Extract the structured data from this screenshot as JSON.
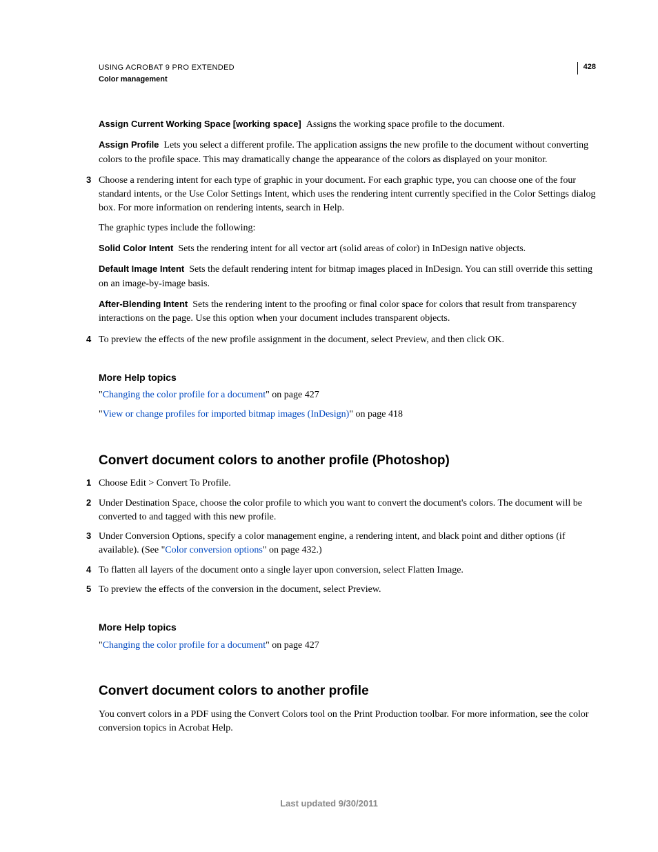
{
  "header": {
    "line1": "USING ACROBAT 9 PRO EXTENDED",
    "line2": "Color management",
    "page_number": "428"
  },
  "defs": [
    {
      "term": "Assign Current Working Space [working space]",
      "text": "Assigns the working space profile to the document."
    },
    {
      "term": "Assign Profile",
      "text": "Lets you select a different profile. The application assigns the new profile to the document without converting colors to the profile space. This may dramatically change the appearance of the colors as displayed on your monitor."
    }
  ],
  "step3": {
    "num": "3",
    "text": "Choose a rendering intent for each type of graphic in your document. For each graphic type, you can choose one of the four standard intents, or the Use Color Settings Intent, which uses the rendering intent currently specified in the Color Settings dialog box. For more information on rendering intents, search in Help."
  },
  "graphic_intro": "The graphic types include the following:",
  "intent_defs": [
    {
      "term": "Solid Color Intent",
      "text": "Sets the rendering intent for all vector art (solid areas of color) in InDesign native objects."
    },
    {
      "term": "Default Image Intent",
      "text": "Sets the default rendering intent for bitmap images placed in InDesign. You can still override this setting on an image-by-image basis."
    },
    {
      "term": "After-Blending Intent",
      "text": "Sets the rendering intent to the proofing or final color space for colors that result from transparency interactions on the page. Use this option when your document includes transparent objects."
    }
  ],
  "step4": {
    "num": "4",
    "text": "To preview the effects of the new profile assignment in the document, select Preview, and then click OK."
  },
  "more_help_1": {
    "title": "More Help topics",
    "links": [
      {
        "text": "Changing the color profile for a document",
        "suffix": "\" on page 427"
      },
      {
        "text": "View or change profiles for imported bitmap images (InDesign)",
        "suffix": "\" on page 418"
      }
    ]
  },
  "section2": {
    "title": "Convert document colors to another profile (Photoshop)",
    "steps": [
      {
        "num": "1",
        "text": "Choose Edit > Convert To Profile."
      },
      {
        "num": "2",
        "text": "Under Destination Space, choose the color profile to which you want to convert the document's colors. The document will be converted to and tagged with this new profile."
      },
      {
        "num": "3",
        "pre": "Under Conversion Options, specify a color management engine, a rendering intent, and black point and dither options (if available). (See \"",
        "link": "Color conversion options",
        "post": "\" on page 432.)"
      },
      {
        "num": "4",
        "text": "To flatten all layers of the document onto a single layer upon conversion, select Flatten Image."
      },
      {
        "num": "5",
        "text": "To preview the effects of the conversion in the document, select Preview."
      }
    ]
  },
  "more_help_2": {
    "title": "More Help topics",
    "links": [
      {
        "text": "Changing the color profile for a document",
        "suffix": "\" on page 427"
      }
    ]
  },
  "section3": {
    "title": "Convert document colors to another profile",
    "body": "You convert colors in a PDF using the Convert Colors tool on the Print Production toolbar. For more information, see the color conversion topics in Acrobat Help."
  },
  "footer": "Last updated 9/30/2011",
  "quote_open": "\"",
  "quote_close": "\""
}
